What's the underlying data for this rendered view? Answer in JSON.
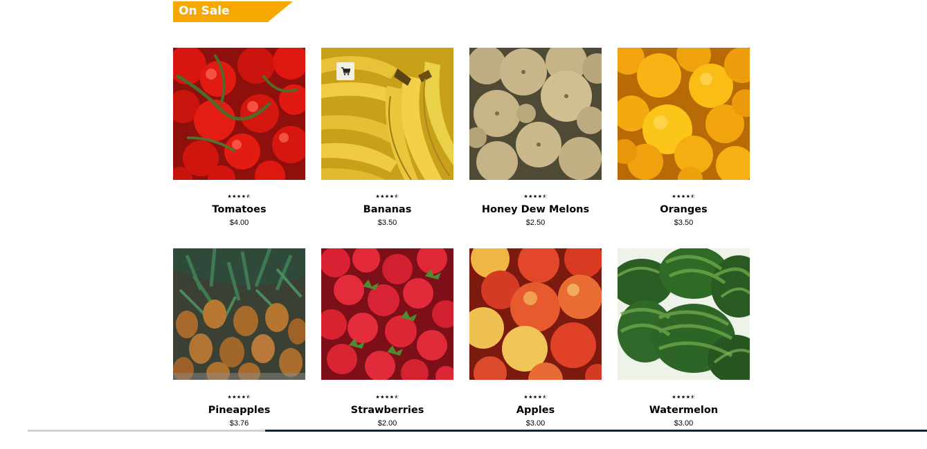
{
  "section": {
    "title": "On Sale",
    "banner_color": "#f7a800"
  },
  "products": [
    {
      "name": "Tomatoes",
      "price": "$4.00",
      "rating": 4.5,
      "stars": "★★★★⯪"
    },
    {
      "name": "Bananas",
      "price": "$3.50",
      "rating": 4.5,
      "stars": "★★★★⯪"
    },
    {
      "name": "Honey Dew Melons",
      "price": "$2.50",
      "rating": 4.5,
      "stars": "★★★★⯪"
    },
    {
      "name": "Oranges",
      "price": "$3.50",
      "rating": 4.5,
      "stars": "★★★★⯪"
    },
    {
      "name": "Pineapples",
      "price": "$3.76",
      "rating": 4.5,
      "stars": "★★★★⯪"
    },
    {
      "name": "Strawberries",
      "price": "$2.00",
      "rating": 4.5,
      "stars": "★★★★⯪"
    },
    {
      "name": "Apples",
      "price": "$3.00",
      "rating": 4.5,
      "stars": "★★★★⯪"
    },
    {
      "name": "Watermelon",
      "price": "$3.00",
      "rating": 4.5,
      "stars": "★★★★⯪"
    }
  ],
  "icons": {
    "cart": "shopping-cart-icon"
  }
}
